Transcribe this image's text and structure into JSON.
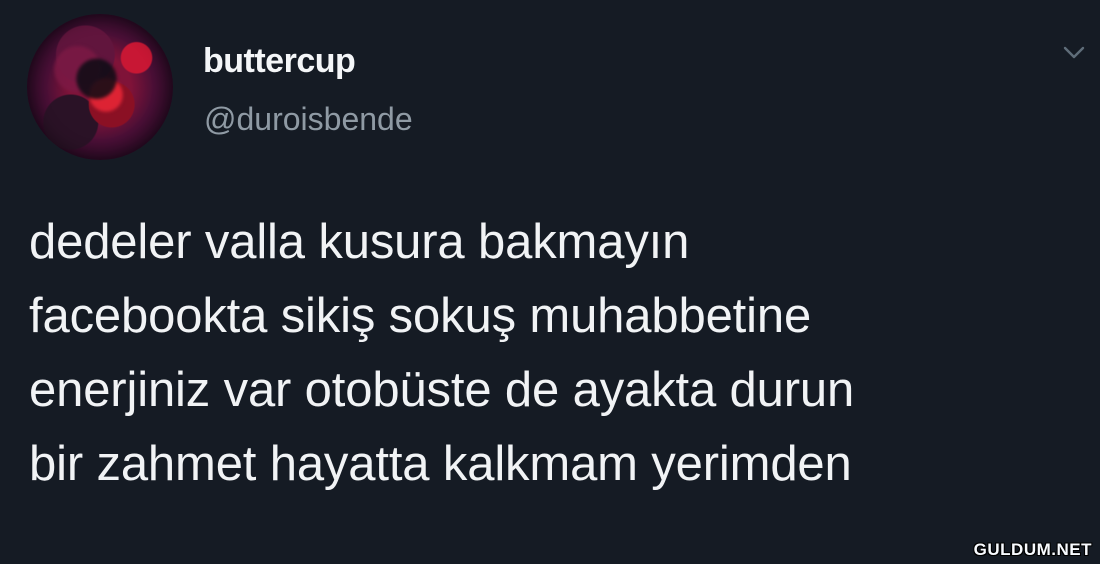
{
  "tweet": {
    "author": {
      "name": "buttercup",
      "handle": "@duroisbende",
      "avatar_icon": "profile-photo"
    },
    "menu_icon": "chevron-down-icon",
    "text_lines": [
      "dedeler valla kusura bakmayın",
      "facebookta sikiş sokuş muhabbetine",
      "enerjiniz var otobüste de ayakta durun",
      "bir zahmet hayatta kalkmam yerimden"
    ]
  },
  "watermark": {
    "text": "GULDUM.NET"
  },
  "colors": {
    "background": "#151b24",
    "name": "#f4f6f8",
    "handle": "#8f9aa4",
    "text": "#f1f3f5",
    "icon": "#5f6d79"
  }
}
